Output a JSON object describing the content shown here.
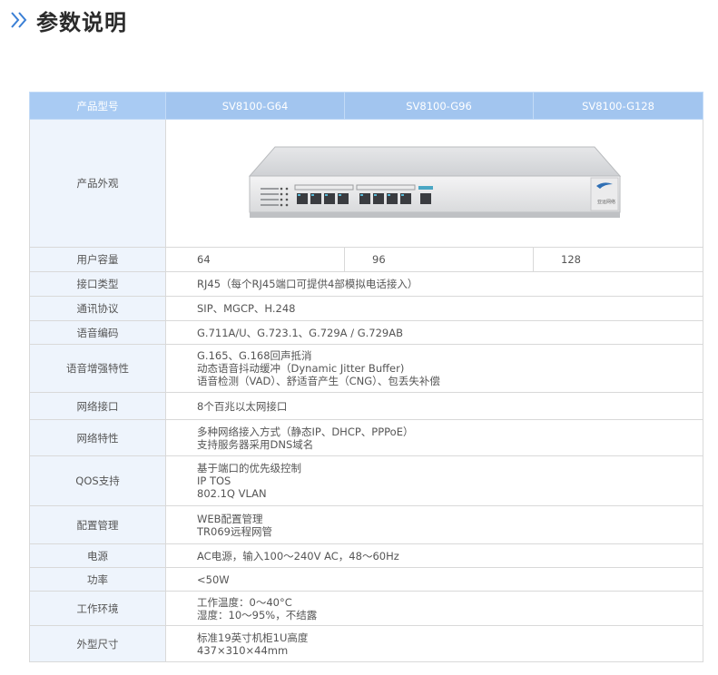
{
  "header": {
    "title": "参数说明"
  },
  "table": {
    "header_label": "产品型号",
    "models": [
      "SV8100-G64",
      "SV8100-G96",
      "SV8100-G128"
    ],
    "appearance_label": "产品外观",
    "device_brand_text": "亚运网络",
    "capacity_label": "用户容量",
    "capacity_values": [
      "64",
      "96",
      "128"
    ],
    "rows": [
      {
        "label": "接口类型",
        "lines": [
          "RJ45（每个RJ45端口可提供4部模拟电话接入）"
        ]
      },
      {
        "label": "通讯协议",
        "lines": [
          "SIP、MGCP、H.248"
        ]
      },
      {
        "label": "语音编码",
        "lines": [
          "G.711A/U、G.723.1、G.729A / G.729AB"
        ]
      },
      {
        "label": "语音增强特性",
        "lines": [
          "G.165、G.168回声抵消",
          "动态语音抖动缓冲（Dynamic Jitter Buffer)",
          "语音检测（VAD）、舒适音产生（CNG）、包丢失补偿"
        ]
      },
      {
        "label": "网络接口",
        "lines": [
          "8个百兆以太网接口"
        ]
      },
      {
        "label": "网络特性",
        "lines": [
          "多种网络接入方式（静态IP、DHCP、PPPoE）",
          "支持服务器采用DNS域名"
        ]
      },
      {
        "label": "QOS支持",
        "lines": [
          "基于端口的优先级控制",
          "IP TOS",
          "802.1Q VLAN"
        ]
      },
      {
        "label": "配置管理",
        "lines": [
          "WEB配置管理",
          "TR069远程网管"
        ]
      },
      {
        "label": "电源",
        "lines": [
          "AC电源，输入100～240V AC，48～60Hz"
        ]
      },
      {
        "label": "功率",
        "lines": [
          "<50W"
        ]
      },
      {
        "label": "工作环境",
        "lines": [
          "工作温度：0～40°C",
          "湿度：10～95%，不结露"
        ]
      },
      {
        "label": "外型尺寸",
        "lines": [
          "标准19英寸机柜1U高度",
          "437×310×44mm"
        ]
      }
    ]
  }
}
